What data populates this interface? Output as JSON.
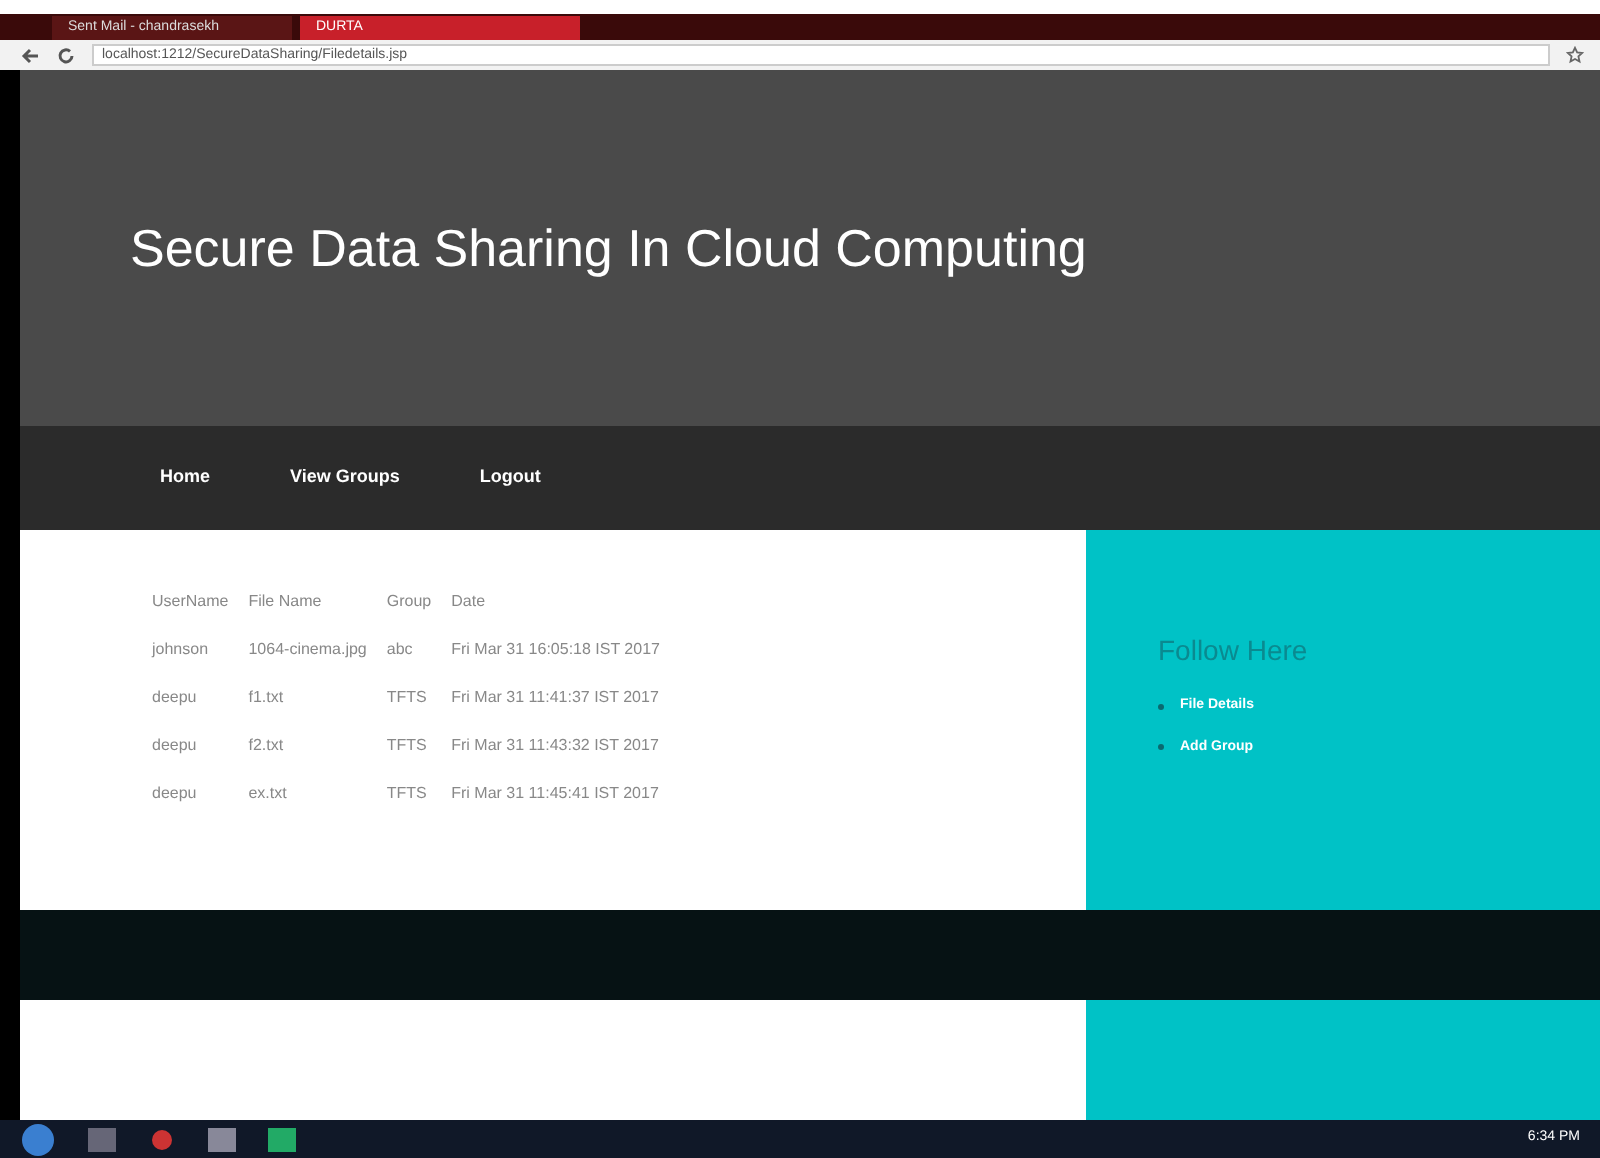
{
  "browser": {
    "tabs": [
      {
        "title": "Sent Mail - chandrasekh",
        "selected": false
      },
      {
        "title": "DURTA",
        "selected": true
      }
    ],
    "address": "localhost:1212/SecureDataSharing/Filedetails.jsp"
  },
  "header": {
    "title": "Secure Data Sharing In Cloud Computing"
  },
  "nav": [
    "Home",
    "View Groups",
    "Logout"
  ],
  "table": {
    "columns": [
      "UserName",
      "File Name",
      "Group",
      "Date"
    ],
    "rows": [
      [
        "johnson",
        "1064-cinema.jpg",
        "abc",
        "Fri Mar 31 16:05:18 IST 2017"
      ],
      [
        "deepu",
        "f1.txt",
        "TFTS",
        "Fri Mar 31 11:41:37 IST 2017"
      ],
      [
        "deepu",
        "f2.txt",
        "TFTS",
        "Fri Mar 31 11:43:32 IST 2017"
      ],
      [
        "deepu",
        "ex.txt",
        "TFTS",
        "Fri Mar 31 11:45:41 IST 2017"
      ]
    ]
  },
  "sidebar": {
    "title": "Follow Here",
    "links": [
      "File Details",
      "Add Group"
    ]
  },
  "taskbar": {
    "time": "6:34 PM"
  }
}
